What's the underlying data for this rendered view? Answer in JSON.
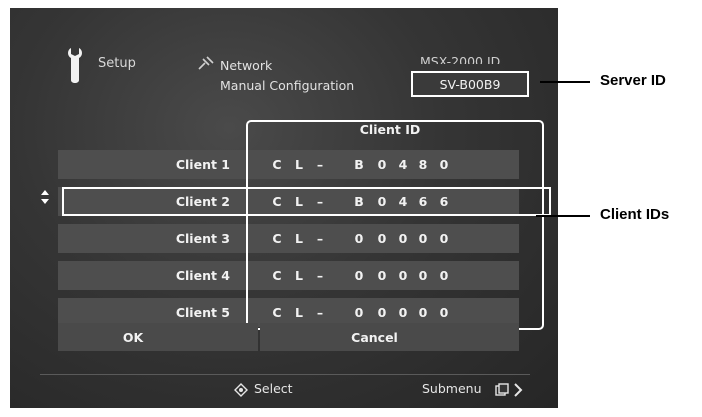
{
  "header": {
    "setup_label": "Setup",
    "network_label": "Network",
    "manual_label": "Manual Configuration",
    "device_label": "MSX-2000 ID",
    "server_id": "SV-B00B9"
  },
  "table": {
    "client_id_header": "Client ID",
    "rows": [
      {
        "name": "Client 1",
        "id": [
          "C",
          "L",
          "–",
          "B",
          "0",
          "4",
          "8",
          "0"
        ]
      },
      {
        "name": "Client 2",
        "id": [
          "C",
          "L",
          "–",
          "B",
          "0",
          "4",
          "6",
          "6"
        ]
      },
      {
        "name": "Client 3",
        "id": [
          "C",
          "L",
          "–",
          "0",
          "0",
          "0",
          "0",
          "0"
        ]
      },
      {
        "name": "Client 4",
        "id": [
          "C",
          "L",
          "–",
          "0",
          "0",
          "0",
          "0",
          "0"
        ]
      },
      {
        "name": "Client 5",
        "id": [
          "C",
          "L",
          "–",
          "0",
          "0",
          "0",
          "0",
          "0"
        ]
      }
    ],
    "selected_row": 2
  },
  "buttons": {
    "ok": "OK",
    "cancel": "Cancel"
  },
  "footer": {
    "select": "Select",
    "submenu": "Submenu"
  },
  "callouts": {
    "server_id": "Server ID",
    "client_ids": "Client IDs"
  },
  "icons": [
    "wrench-icon",
    "network-icon",
    "updown-arrow-icon",
    "select-dpad-icon",
    "submenu-icon",
    "chevron-right-icon"
  ]
}
